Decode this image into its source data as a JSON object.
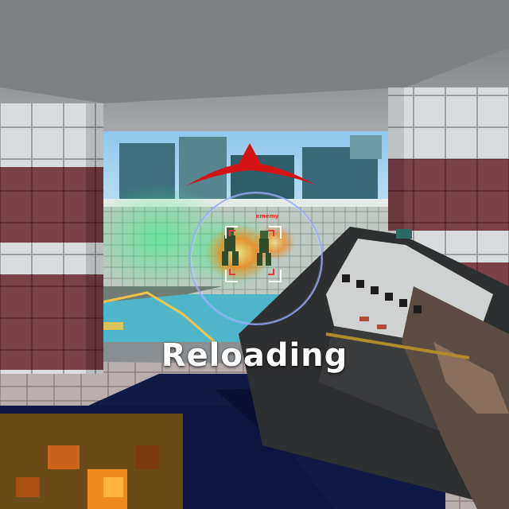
{
  "hud": {
    "status_text": "Reloading",
    "enemy_tag": "ememy",
    "colors": {
      "direction_indicator": "#d41414",
      "crosshair_ring": "#96aaff",
      "crosshair_brackets": "#ffffff",
      "enemy_tag": "#ff2b2b"
    },
    "icons": [
      "damage-direction-indicator-icon",
      "crosshair-icon"
    ]
  }
}
